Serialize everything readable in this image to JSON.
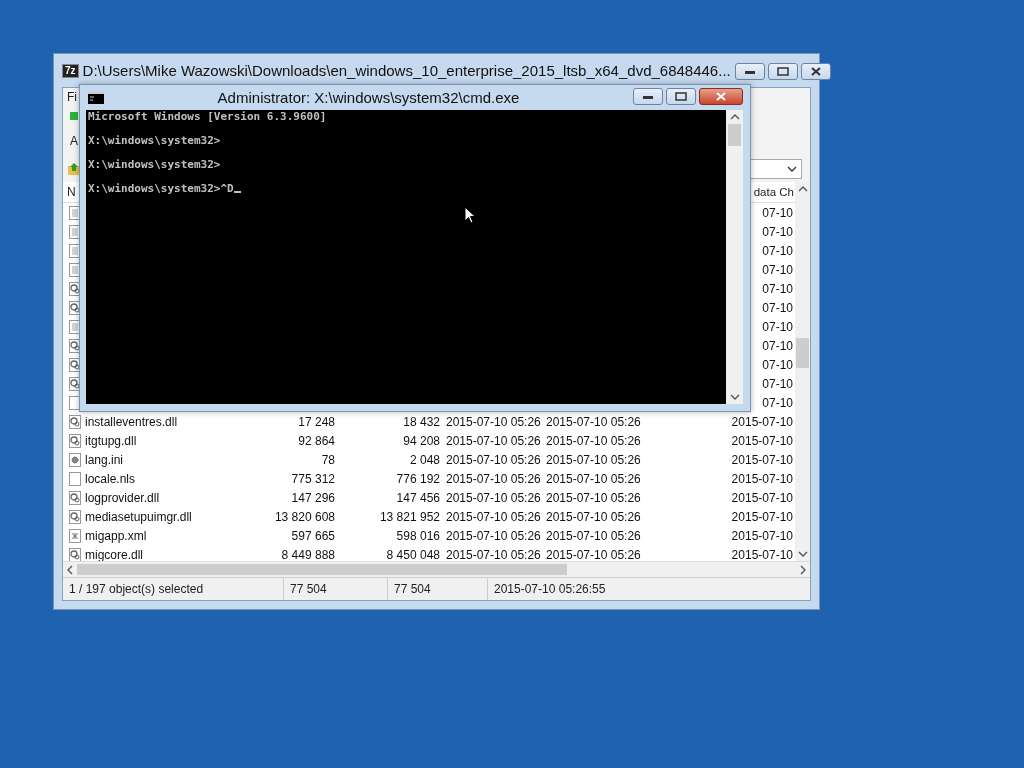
{
  "archive_window": {
    "app_icon_text": "7z",
    "title": "D:\\Users\\Mike Wazowski\\Downloads\\en_windows_10_enterprise_2015_ltsb_x64_dvd_6848446...",
    "menu": [
      "Fi"
    ],
    "toolbar": [
      "A"
    ],
    "columns": [
      "N",
      "data Ch"
    ],
    "rows": [
      {
        "kind": "doc",
        "last": "07-10"
      },
      {
        "kind": "doc",
        "last": "07-10"
      },
      {
        "kind": "doc",
        "last": "07-10"
      },
      {
        "kind": "doc",
        "last": "07-10"
      },
      {
        "kind": "dll",
        "last": "07-10"
      },
      {
        "kind": "dll",
        "last": "07-10"
      },
      {
        "kind": "doc",
        "last": "07-10"
      },
      {
        "kind": "dll",
        "last": "07-10"
      },
      {
        "kind": "dll",
        "last": "07-10"
      },
      {
        "kind": "dll",
        "last": "07-10"
      },
      {
        "kind": "blank",
        "last": "07-10"
      },
      {
        "kind": "dll",
        "name": "installeventres.dll",
        "size": "17 248",
        "packed": "18 432",
        "modified": "2015-07-10 05:26",
        "created": "2015-07-10 05:26",
        "last": "2015-07-10"
      },
      {
        "kind": "dll",
        "name": "itgtupg.dll",
        "size": "92 864",
        "packed": "94 208",
        "modified": "2015-07-10 05:26",
        "created": "2015-07-10 05:26",
        "last": "2015-07-10"
      },
      {
        "kind": "ini",
        "name": "lang.ini",
        "size": "78",
        "packed": "2 048",
        "modified": "2015-07-10 05:26",
        "created": "2015-07-10 05:26",
        "last": "2015-07-10"
      },
      {
        "kind": "blank",
        "name": "locale.nls",
        "size": "775 312",
        "packed": "776 192",
        "modified": "2015-07-10 05:26",
        "created": "2015-07-10 05:26",
        "last": "2015-07-10"
      },
      {
        "kind": "dll",
        "name": "logprovider.dll",
        "size": "147 296",
        "packed": "147 456",
        "modified": "2015-07-10 05:26",
        "created": "2015-07-10 05:26",
        "last": "2015-07-10"
      },
      {
        "kind": "dll",
        "name": "mediasetupuimgr.dll",
        "size": "13 820 608",
        "packed": "13 821 952",
        "modified": "2015-07-10 05:26",
        "created": "2015-07-10 05:26",
        "last": "2015-07-10"
      },
      {
        "kind": "xml",
        "name": "migapp.xml",
        "size": "597 665",
        "packed": "598 016",
        "modified": "2015-07-10 05:26",
        "created": "2015-07-10 05:26",
        "last": "2015-07-10"
      },
      {
        "kind": "dll",
        "name": "migcore.dll",
        "size": "8 449 888",
        "packed": "8 450 048",
        "modified": "2015-07-10 05:26",
        "created": "2015-07-10 05:26",
        "last": "2015-07-10"
      }
    ],
    "status_bar": [
      "1 / 197 object(s) selected",
      "77 504",
      "77 504",
      "2015-07-10 05:26:55"
    ]
  },
  "console_window": {
    "title": "Administrator: X:\\windows\\system32\\cmd.exe",
    "lines": [
      "Microsoft Windows [Version 6.3.9600]",
      "X:\\windows\\system32>",
      "X:\\windows\\system32>",
      "X:\\windows\\system32>^D"
    ]
  }
}
